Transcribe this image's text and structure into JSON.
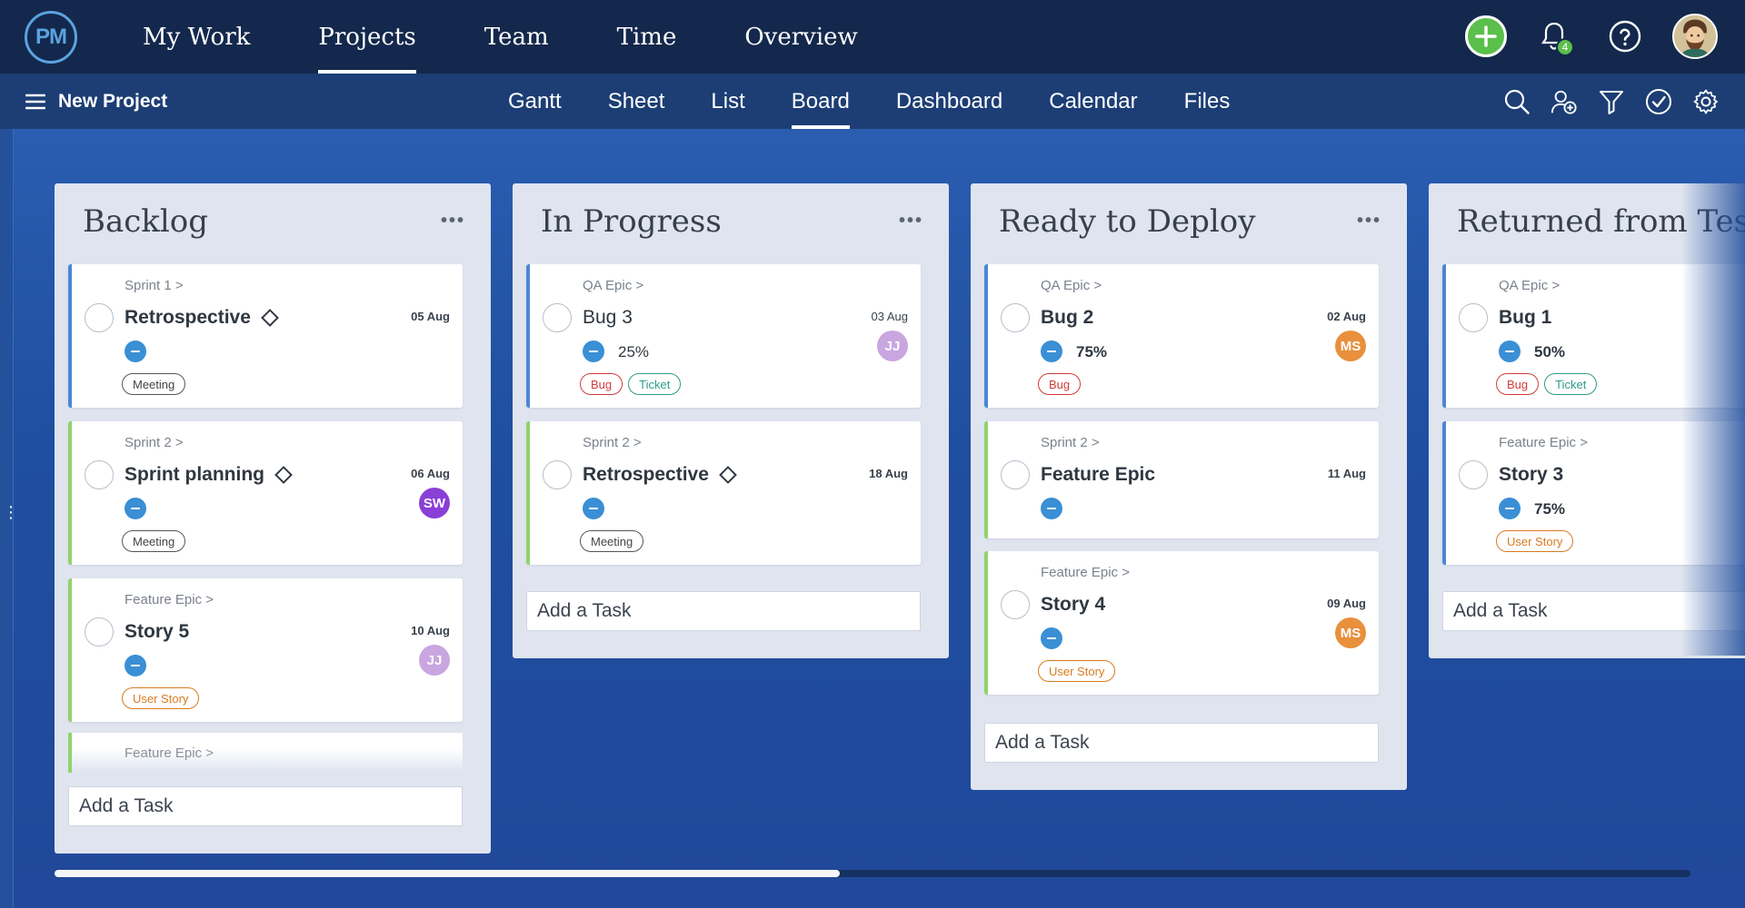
{
  "topnav": {
    "logo": "PM",
    "items": [
      "My Work",
      "Projects",
      "Team",
      "Time",
      "Overview"
    ],
    "active": "Projects",
    "notifications_count": "4"
  },
  "subnav": {
    "project_label": "New Project",
    "views": [
      "Gantt",
      "Sheet",
      "List",
      "Board",
      "Dashboard",
      "Calendar",
      "Files"
    ],
    "active_view": "Board"
  },
  "columns": [
    {
      "title": "Backlog",
      "cards": [
        {
          "crumb": "Sprint 1 >",
          "name": "Retrospective",
          "milestone": true,
          "date": "05 Aug",
          "tags": [
            {
              "label": "Meeting",
              "kind": "meeting"
            }
          ],
          "border": "blue"
        },
        {
          "crumb": "Sprint 2 >",
          "name": "Sprint planning",
          "milestone": true,
          "date": "06 Aug",
          "avatar": "SW",
          "tags": [
            {
              "label": "Meeting",
              "kind": "meeting"
            }
          ],
          "border": "green"
        },
        {
          "crumb": "Feature Epic >",
          "name": "Story 5",
          "date": "10 Aug",
          "avatar": "JJ",
          "tags": [
            {
              "label": "User Story",
              "kind": "story"
            }
          ],
          "border": "green"
        }
      ],
      "partial_card_crumb": "Feature Epic >",
      "add_task": "Add a Task"
    },
    {
      "title": "In Progress",
      "cards": [
        {
          "crumb": "QA Epic >",
          "name": "Bug 3",
          "percent": "25%",
          "date": "03 Aug",
          "avatar": "JJ",
          "tags": [
            {
              "label": "Bug",
              "kind": "bug"
            },
            {
              "label": "Ticket",
              "kind": "ticket"
            }
          ],
          "border": "blue"
        },
        {
          "crumb": "Sprint 2 >",
          "name": "Retrospective",
          "milestone": true,
          "date": "18 Aug",
          "tags": [
            {
              "label": "Meeting",
              "kind": "meeting"
            }
          ],
          "border": "green"
        }
      ],
      "add_task": "Add a Task"
    },
    {
      "title": "Ready to Deploy",
      "cards": [
        {
          "crumb": "QA Epic >",
          "name": "Bug 2",
          "percent": "75%",
          "date": "02 Aug",
          "avatar": "MS",
          "tags": [
            {
              "label": "Bug",
              "kind": "bug"
            }
          ],
          "border": "blue"
        },
        {
          "crumb": "Sprint 2 >",
          "name": "Feature Epic",
          "date": "11 Aug",
          "tags": [],
          "border": "green"
        },
        {
          "crumb": "Feature Epic >",
          "name": "Story 4",
          "date": "09 Aug",
          "avatar": "MS",
          "tags": [
            {
              "label": "User Story",
              "kind": "story"
            }
          ],
          "border": "green"
        }
      ],
      "add_task": "Add a Task"
    },
    {
      "title": "Returned from Test",
      "cards": [
        {
          "crumb": "QA Epic >",
          "name": "Bug 1",
          "percent": "50%",
          "tags": [
            {
              "label": "Bug",
              "kind": "bug"
            },
            {
              "label": "Ticket",
              "kind": "ticket"
            }
          ],
          "border": "blue"
        },
        {
          "crumb": "Feature Epic >",
          "name": "Story 3",
          "percent": "75%",
          "tags": [
            {
              "label": "User Story",
              "kind": "story"
            }
          ],
          "border": "blue"
        }
      ],
      "add_task": "Add a Task"
    }
  ],
  "colors": {
    "topnav_bg": "#13284c",
    "subnav_bg": "#1c3e74",
    "accent_green": "#5bbf4b",
    "priority_blue": "#3a8fd5",
    "avatar_SW": "#8a3fd6",
    "avatar_JJ": "#c9a6e0",
    "avatar_MS": "#e8903c"
  },
  "scrollbar": {
    "position_fraction": 0.48
  }
}
